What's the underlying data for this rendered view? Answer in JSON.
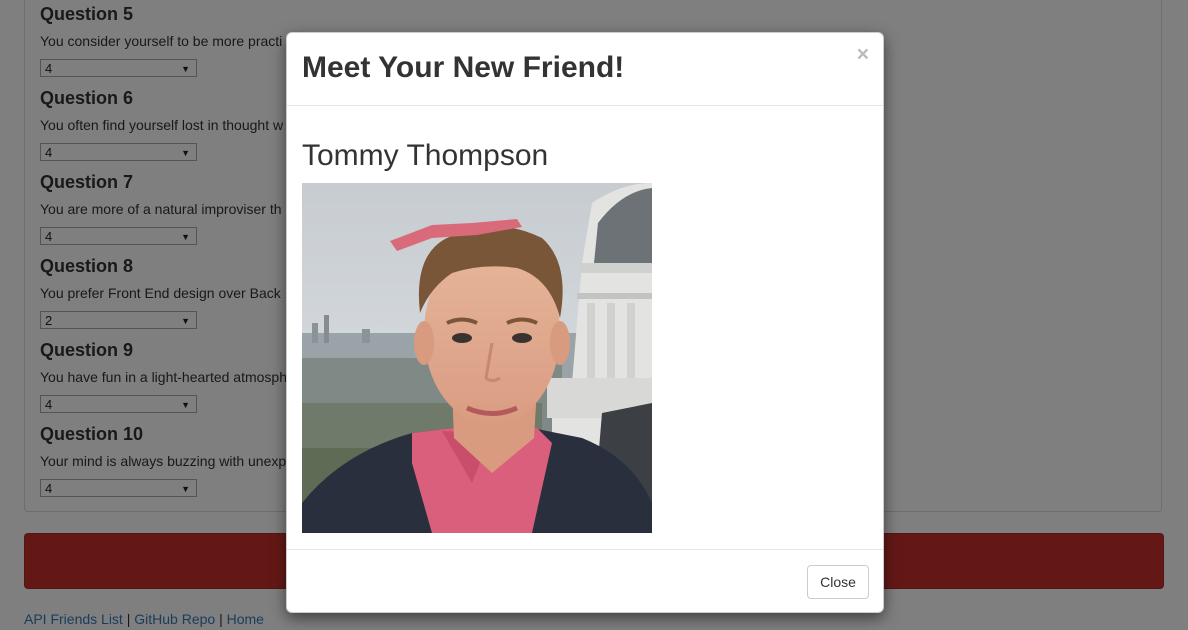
{
  "questions": [
    {
      "title": "Question 5",
      "text": "You consider yourself to be more practi",
      "value": "4"
    },
    {
      "title": "Question 6",
      "text": "You often find yourself lost in thought w",
      "value": "4"
    },
    {
      "title": "Question 7",
      "text": "You are more of a natural improviser th",
      "value": "4"
    },
    {
      "title": "Question 8",
      "text": "You prefer Front End design over Back",
      "value": "2"
    },
    {
      "title": "Question 9",
      "text": "You have fun in a light-hearted atmosph",
      "value": "4"
    },
    {
      "title": "Question 10",
      "text": "Your mind is always buzzing with unexp",
      "value": "4"
    }
  ],
  "footer": {
    "link1": "API Friends List",
    "sep": "|",
    "link2": "GitHub Repo",
    "link3": "Home"
  },
  "modal": {
    "title": "Meet Your New Friend!",
    "close_symbol": "×",
    "friend_name": "Tommy Thompson",
    "close_label": "Close"
  },
  "colors": {
    "submit_bar": "#c9302c",
    "link": "#337ab7"
  }
}
